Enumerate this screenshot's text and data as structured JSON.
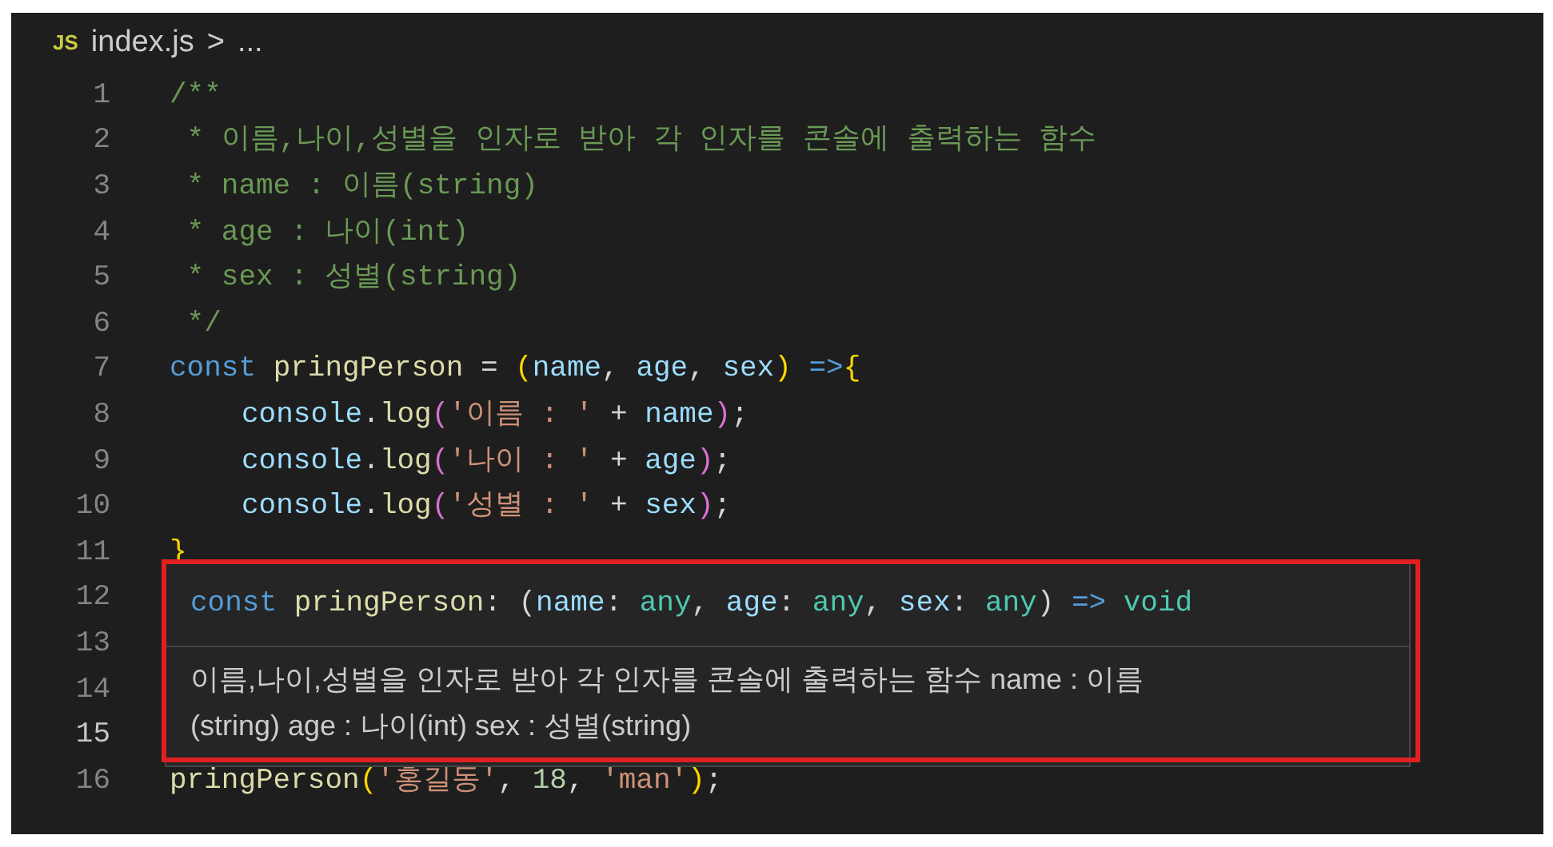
{
  "breadcrumb": {
    "file_badge": "JS",
    "file": "index.js",
    "separator": ">",
    "rest": "..."
  },
  "lines": [
    {
      "number": "1",
      "current": false,
      "tokens": [
        {
          "kind": "comment",
          "text": "/**"
        }
      ]
    },
    {
      "number": "2",
      "current": false,
      "tokens": [
        {
          "kind": "comment",
          "text": " * 이름,나이,성별을 인자로 받아 각 인자를 콘솔에 출력하는 함수"
        }
      ]
    },
    {
      "number": "3",
      "current": false,
      "tokens": [
        {
          "kind": "comment",
          "text": " * name : 이름(string)"
        }
      ]
    },
    {
      "number": "4",
      "current": false,
      "tokens": [
        {
          "kind": "comment",
          "text": " * age : 나이(int)"
        }
      ]
    },
    {
      "number": "5",
      "current": false,
      "tokens": [
        {
          "kind": "comment",
          "text": " * sex : 성별(string)"
        }
      ]
    },
    {
      "number": "6",
      "current": false,
      "tokens": [
        {
          "kind": "comment",
          "text": " */"
        }
      ]
    },
    {
      "number": "7",
      "current": false,
      "tokens": [
        {
          "kind": "keyword",
          "text": "const "
        },
        {
          "kind": "function",
          "text": "pringPerson"
        },
        {
          "kind": "plain",
          "text": " = "
        },
        {
          "kind": "bracket1",
          "text": "("
        },
        {
          "kind": "variable",
          "text": "name"
        },
        {
          "kind": "plain",
          "text": ", "
        },
        {
          "kind": "variable",
          "text": "age"
        },
        {
          "kind": "plain",
          "text": ", "
        },
        {
          "kind": "variable",
          "text": "sex"
        },
        {
          "kind": "bracket1",
          "text": ")"
        },
        {
          "kind": "keyword",
          "text": " =>"
        },
        {
          "kind": "bracket1",
          "text": "{"
        }
      ]
    },
    {
      "number": "8",
      "current": false,
      "indented": true,
      "tokens": [
        {
          "kind": "variable",
          "text": "console"
        },
        {
          "kind": "plain",
          "text": "."
        },
        {
          "kind": "function",
          "text": "log"
        },
        {
          "kind": "bracket2",
          "text": "("
        },
        {
          "kind": "string",
          "text": "'이름 : '"
        },
        {
          "kind": "plain",
          "text": " + "
        },
        {
          "kind": "variable",
          "text": "name"
        },
        {
          "kind": "bracket2",
          "text": ")"
        },
        {
          "kind": "plain",
          "text": ";"
        }
      ]
    },
    {
      "number": "9",
      "current": false,
      "indented": true,
      "tokens": [
        {
          "kind": "variable",
          "text": "console"
        },
        {
          "kind": "plain",
          "text": "."
        },
        {
          "kind": "function",
          "text": "log"
        },
        {
          "kind": "bracket2",
          "text": "("
        },
        {
          "kind": "string",
          "text": "'나이 : '"
        },
        {
          "kind": "plain",
          "text": " + "
        },
        {
          "kind": "variable",
          "text": "age"
        },
        {
          "kind": "bracket2",
          "text": ")"
        },
        {
          "kind": "plain",
          "text": ";"
        }
      ]
    },
    {
      "number": "10",
      "current": false,
      "indented": true,
      "tokens": [
        {
          "kind": "variable",
          "text": "console"
        },
        {
          "kind": "plain",
          "text": "."
        },
        {
          "kind": "function",
          "text": "log"
        },
        {
          "kind": "bracket2",
          "text": "("
        },
        {
          "kind": "string",
          "text": "'성별 : '"
        },
        {
          "kind": "plain",
          "text": " + "
        },
        {
          "kind": "variable",
          "text": "sex"
        },
        {
          "kind": "bracket2",
          "text": ")"
        },
        {
          "kind": "plain",
          "text": ";"
        }
      ]
    },
    {
      "number": "11",
      "current": false,
      "tokens": [
        {
          "kind": "bracket1",
          "text": "}"
        }
      ]
    },
    {
      "number": "12",
      "current": false
    },
    {
      "number": "13",
      "current": false
    },
    {
      "number": "14",
      "current": false
    },
    {
      "number": "15",
      "current": true
    },
    {
      "number": "16",
      "current": false,
      "tokens": [
        {
          "kind": "function",
          "text": "pringPerson"
        },
        {
          "kind": "bracket1",
          "text": "("
        },
        {
          "kind": "string",
          "text": "'홍길동'"
        },
        {
          "kind": "plain",
          "text": ", "
        },
        {
          "kind": "number",
          "text": "18"
        },
        {
          "kind": "plain",
          "text": ", "
        },
        {
          "kind": "string",
          "text": "'man'"
        },
        {
          "kind": "bracket1",
          "text": ")"
        },
        {
          "kind": "plain",
          "text": ";"
        }
      ]
    }
  ],
  "hover": {
    "annotated": true,
    "signature": [
      {
        "kind": "keyword",
        "text": "const "
      },
      {
        "kind": "function",
        "text": "pringPerson"
      },
      {
        "kind": "plain",
        "text": ": ("
      },
      {
        "kind": "variable",
        "text": "name"
      },
      {
        "kind": "plain",
        "text": ": "
      },
      {
        "kind": "type",
        "text": "any"
      },
      {
        "kind": "plain",
        "text": ", "
      },
      {
        "kind": "variable",
        "text": "age"
      },
      {
        "kind": "plain",
        "text": ": "
      },
      {
        "kind": "type",
        "text": "any"
      },
      {
        "kind": "plain",
        "text": ", "
      },
      {
        "kind": "variable",
        "text": "sex"
      },
      {
        "kind": "plain",
        "text": ": "
      },
      {
        "kind": "type",
        "text": "any"
      },
      {
        "kind": "plain",
        "text": ") "
      },
      {
        "kind": "keyword",
        "text": "=> "
      },
      {
        "kind": "type",
        "text": "void"
      }
    ],
    "doc": "이름,나이,성별을 인자로 받아 각 인자를 콘솔에 출력하는 함수 name : 이름 (string) age : 나이(int) sex : 성별(string)"
  }
}
